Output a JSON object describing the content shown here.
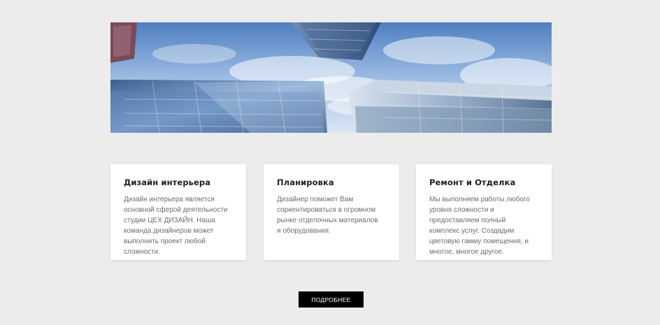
{
  "hero": {
    "image_alt": "skyscrapers-sky-image"
  },
  "cards": [
    {
      "title": "Дизайн интерьера",
      "text": "Дизайн интерьера является\nосновной сферой деятельности\nстудии ЦЕХ ДИЗАЙН. Наша\nкоманда дизайнеров может\nвыполнить проект любой\nсложности."
    },
    {
      "title": "Планировка",
      "text": "Дизайнер поможет Вам\nсориентироваться в огромном\nрынке отделочных материалов\nи оборудования."
    },
    {
      "title": "Ремонт и Отделка",
      "text": "Мы выполняем работы любого\nуровня сложности и\nпредоставляем полный\nкомплекс услуг. Создадим\nцветовую гамму помещения, и\nмногое, многое другое."
    }
  ],
  "button": {
    "label": "ПОДРОБНЕЕ"
  },
  "colors": {
    "background": "#ececec",
    "card": "#ffffff",
    "button": "#000000",
    "button_text": "#ffffff"
  }
}
